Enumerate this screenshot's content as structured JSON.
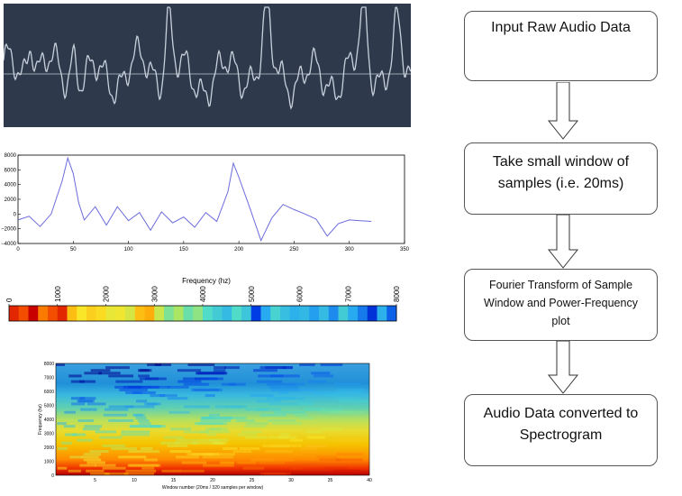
{
  "chart_data": [
    {
      "type": "line",
      "title": "",
      "xlabel": "",
      "ylabel": "",
      "x": [
        0,
        10,
        20,
        30,
        40,
        45,
        50,
        55,
        60,
        70,
        80,
        90,
        100,
        110,
        120,
        130,
        140,
        150,
        160,
        170,
        180,
        190,
        195,
        200,
        210,
        220,
        230,
        240,
        250,
        260,
        270,
        280,
        290,
        300,
        310,
        320
      ],
      "y": [
        -800,
        -300,
        -1700,
        0,
        4500,
        7600,
        5500,
        1500,
        -800,
        1000,
        -1500,
        1000,
        -900,
        200,
        -2200,
        300,
        -1200,
        -400,
        -1800,
        200,
        -1000,
        3000,
        6900,
        5000,
        800,
        -3600,
        -500,
        1300,
        600,
        0,
        -700,
        -3000,
        -1300,
        -800,
        -900,
        -1000
      ],
      "xlim": [
        0,
        350
      ],
      "ylim": [
        -4000,
        8000
      ],
      "xticks": [
        "0",
        "50",
        "100",
        "150",
        "200",
        "250",
        "300",
        "350"
      ],
      "yticks": [
        "−4000",
        "−2000",
        "0",
        "2000",
        "4000",
        "6000",
        "8000"
      ],
      "line_color": "#6b6bdc"
    },
    {
      "type": "heatmap",
      "title": "Frequency (hz)",
      "xlabel": "Frequency (hz)",
      "xlim": [
        0,
        8000
      ],
      "xticks": [
        "0",
        "1000",
        "2000",
        "3000",
        "4000",
        "5000",
        "6000",
        "7000",
        "8000"
      ],
      "values": [
        0.95,
        0.9,
        1.0,
        0.85,
        0.9,
        0.95,
        0.75,
        0.68,
        0.72,
        0.7,
        0.65,
        0.66,
        0.62,
        0.75,
        0.78,
        0.6,
        0.5,
        0.55,
        0.48,
        0.52,
        0.45,
        0.4,
        0.35,
        0.45,
        0.38,
        0.12,
        0.3,
        0.42,
        0.36,
        0.32,
        0.34,
        0.28,
        0.35,
        0.25,
        0.4,
        0.3,
        0.22,
        0.1,
        0.32,
        0.18
      ]
    },
    {
      "type": "heatmap",
      "xlabel": "Window number (20ms / 320 samples per window)",
      "ylabel": "Frequency (hz)",
      "xlim": [
        0,
        40
      ],
      "ylim": [
        0,
        8000
      ],
      "xticks": [
        "5",
        "10",
        "15",
        "20",
        "25",
        "30",
        "35",
        "40"
      ],
      "yticks": [
        "0",
        "1000",
        "2000",
        "3000",
        "4000",
        "5000",
        "6000",
        "7000",
        "8000"
      ]
    }
  ],
  "flowchart": {
    "step1": "Input Raw Audio Data",
    "step2_line1": "Take small window of",
    "step2_line2": "samples (i.e. 20ms)",
    "step3_line1": "Fourier Transform of Sample",
    "step3_line2": "Window and Power-Frequency",
    "step3_line3": "plot",
    "step4_line1": "Audio Data converted to",
    "step4_line2": "Spectrogram"
  },
  "colors": {
    "waveform_bg": "#2e3a4b",
    "waveform_line": "#c8d0dc",
    "box_border": "#555555"
  }
}
